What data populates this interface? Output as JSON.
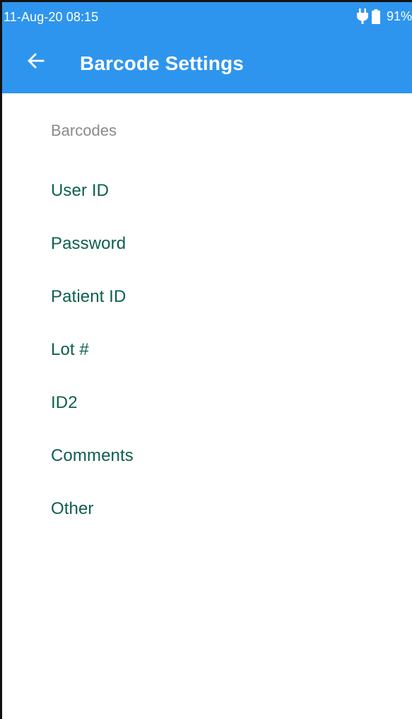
{
  "status_bar": {
    "time": "11-Aug-20 08:15",
    "battery_percent": "91%",
    "icons": [
      "plug-icon",
      "battery-icon"
    ]
  },
  "toolbar": {
    "back_icon": "back-arrow-icon",
    "title": "Barcode Settings"
  },
  "section": {
    "header": "Barcodes"
  },
  "items": [
    {
      "label": "User ID"
    },
    {
      "label": "Password"
    },
    {
      "label": "Patient ID"
    },
    {
      "label": "Lot #"
    },
    {
      "label": "ID2"
    },
    {
      "label": "Comments"
    },
    {
      "label": "Other"
    }
  ],
  "colors": {
    "app_bar": "#2e95ee",
    "item_text": "#0d5f4e",
    "section_header": "#8a8a8a",
    "background": "#ffffff"
  }
}
